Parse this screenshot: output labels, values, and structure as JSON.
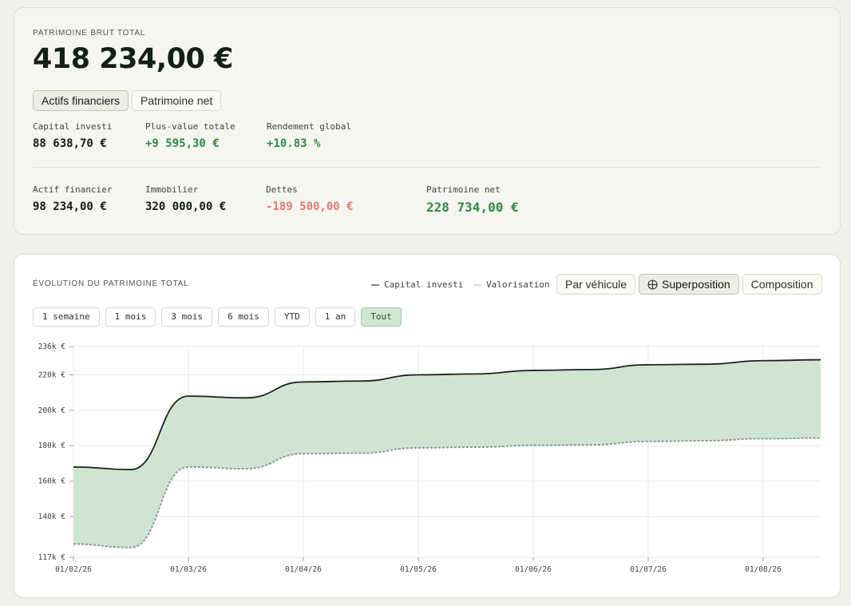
{
  "summary": {
    "eyebrow": "PATRIMOINE BRUT TOTAL",
    "total": "418 234,00 €",
    "toggles": [
      {
        "label": "Actifs financiers",
        "active": true
      },
      {
        "label": "Patrimoine net",
        "active": false
      }
    ],
    "stats_top": [
      {
        "label": "Capital investi",
        "value": "88 638,70 €",
        "tone": "neutral"
      },
      {
        "label": "Plus-value totale",
        "value": "+9 595,30 €",
        "tone": "pos"
      },
      {
        "label": "Rendement global",
        "value": "+10.83 %",
        "tone": "pos"
      }
    ],
    "stats_bottom": [
      {
        "label": "Actif financier",
        "value": "98 234,00 €",
        "tone": "neutral"
      },
      {
        "label": "Immobilier",
        "value": "320 000,00 €",
        "tone": "neutral"
      },
      {
        "label": "Dettes",
        "value": "-189 500,00 €",
        "tone": "neg"
      },
      {
        "label": "Patrimoine net",
        "value": "228 734,00 €",
        "tone": "pos"
      }
    ]
  },
  "chart_card": {
    "title": "ÉVOLUTION DU PATRIMOINE TOTAL",
    "legend": [
      {
        "label": "Capital investi",
        "color": "#7c8a98"
      },
      {
        "label": "Valorisation",
        "color": "#cfd6c9"
      }
    ],
    "views": [
      {
        "label": "Par véhicule",
        "active": false,
        "icon": ""
      },
      {
        "label": "Superposition",
        "active": true,
        "icon": "crosshair-circle-icon"
      },
      {
        "label": "Composition",
        "active": false,
        "icon": ""
      }
    ],
    "ranges": [
      {
        "label": "1 semaine",
        "active": false
      },
      {
        "label": "1 mois",
        "active": false
      },
      {
        "label": "3 mois",
        "active": false
      },
      {
        "label": "6 mois",
        "active": false
      },
      {
        "label": "YTD",
        "active": false
      },
      {
        "label": "1 an",
        "active": false
      },
      {
        "label": "Tout",
        "active": true
      }
    ]
  },
  "colors": {
    "positive": "#2f8a45",
    "negative": "#e07a74",
    "area_fill": "#cfe5d1",
    "valuation_line": "#17251a",
    "capital_line": "#8995a3"
  },
  "chart_data": {
    "type": "area",
    "x": [
      "01/02/26",
      "15/02/26",
      "01/03/26",
      "15/03/26",
      "01/04/26",
      "15/04/26",
      "01/05/26",
      "15/05/26",
      "01/06/26",
      "15/06/26",
      "01/07/26",
      "15/07/26",
      "01/08/26",
      "15/08/26"
    ],
    "x_ticks": [
      "01/02/26",
      "01/03/26",
      "01/04/26",
      "01/05/26",
      "01/06/26",
      "01/07/26",
      "01/08/26"
    ],
    "series": [
      {
        "name": "Valorisation",
        "values": [
          168000,
          166500,
          208000,
          207000,
          216000,
          216500,
          220000,
          220500,
          222500,
          223000,
          225700,
          226000,
          228000,
          228500
        ]
      },
      {
        "name": "Capital investi",
        "values": [
          124500,
          122500,
          168000,
          167000,
          175500,
          175800,
          178800,
          179200,
          180200,
          180500,
          182400,
          182800,
          184000,
          184300
        ]
      }
    ],
    "y_ticks": [
      "236k €",
      "220k €",
      "200k €",
      "180k €",
      "160k €",
      "140k €",
      "117k €"
    ],
    "y_tick_values": [
      236000,
      220000,
      200000,
      180000,
      160000,
      140000,
      117000
    ],
    "ylim": [
      117000,
      236000
    ],
    "grid": true,
    "legend_position": "top-right"
  }
}
